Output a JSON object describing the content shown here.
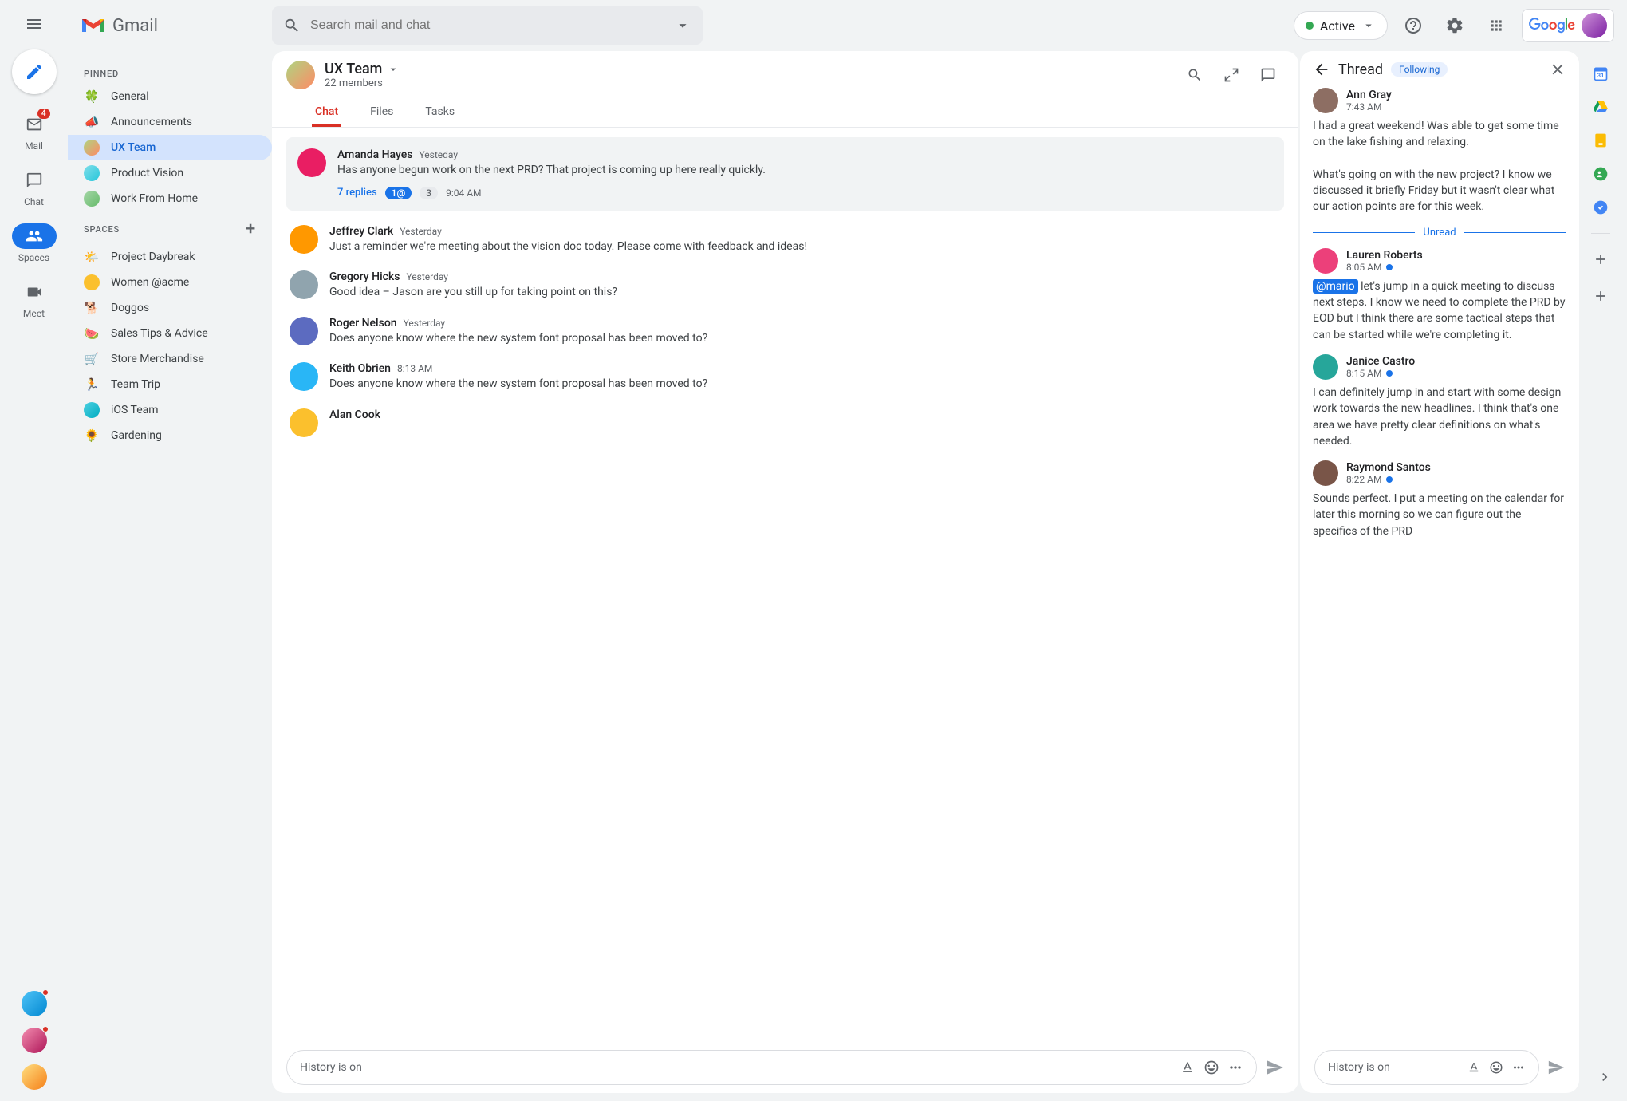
{
  "app_name": "Gmail",
  "search": {
    "placeholder": "Search mail and chat"
  },
  "status": {
    "label": "Active"
  },
  "brand": "Google",
  "rail": {
    "mail": {
      "label": "Mail",
      "badge": "4"
    },
    "chat": {
      "label": "Chat"
    },
    "spaces": {
      "label": "Spaces"
    },
    "meet": {
      "label": "Meet"
    }
  },
  "sidebar": {
    "pinned_heading": "PINNED",
    "spaces_heading": "SPACES",
    "pinned": [
      {
        "emoji": "🍀",
        "label": "General"
      },
      {
        "emoji": "📣",
        "label": "Announcements"
      },
      {
        "emoji": "",
        "label": "UX Team",
        "active": true
      },
      {
        "emoji": "",
        "label": "Product Vision"
      },
      {
        "emoji": "",
        "label": "Work From Home"
      }
    ],
    "spaces": [
      {
        "emoji": "🌤️",
        "label": "Project Daybreak"
      },
      {
        "emoji": "",
        "label": "Women @acme"
      },
      {
        "emoji": "🐕",
        "label": "Doggos"
      },
      {
        "emoji": "🍉",
        "label": "Sales Tips & Advice"
      },
      {
        "emoji": "🛒",
        "label": "Store Merchandise"
      },
      {
        "emoji": "🏃",
        "label": "Team Trip"
      },
      {
        "emoji": "",
        "label": "iOS Team"
      },
      {
        "emoji": "🌻",
        "label": "Gardening"
      }
    ]
  },
  "space": {
    "name": "UX Team",
    "subtitle": "22 members",
    "tabs": [
      "Chat",
      "Files",
      "Tasks"
    ]
  },
  "messages": [
    {
      "name": "Amanda Hayes",
      "time": "Yesteday",
      "body": "Has anyone begun work on the next PRD? That project is coming up here really quickly.",
      "replies": "7 replies",
      "pill1": "1@",
      "pill2": "3",
      "reply_time": "9:04 AM",
      "highlighted": true
    },
    {
      "name": "Jeffrey Clark",
      "time": "Yesterday",
      "body": "Just a reminder we're meeting about the vision doc today. Please come with feedback and ideas!"
    },
    {
      "name": "Gregory Hicks",
      "time": "Yesterday",
      "body": "Good idea – Jason are you still up for taking point on this?"
    },
    {
      "name": "Roger Nelson",
      "time": "Yesterday",
      "body": "Does anyone know where the new system font proposal has been moved to?"
    },
    {
      "name": "Keith Obrien",
      "time": "8:13 AM",
      "body": "Does anyone know where the new system font proposal has been moved to?"
    },
    {
      "name": "Alan Cook",
      "time": "",
      "body": ""
    }
  ],
  "thread": {
    "title": "Thread",
    "following": "Following",
    "unread_label": "Unread",
    "messages": [
      {
        "name": "Ann Gray",
        "time": "7:43 AM",
        "body": "I had a great weekend! Was able to get some time on the lake fishing and relaxing.\n\nWhat's going on with the new project? I know we discussed it briefly Friday but it wasn't clear what our action points are for this week.",
        "unread": false
      },
      {
        "name": "Lauren Roberts",
        "time": "8:05 AM",
        "mention": "@mario",
        "body": " let's jump in a quick meeting to discuss next steps. I know we need to complete the PRD by EOD but I think there are some tactical steps that can be started while we're completing it.",
        "unread": true
      },
      {
        "name": "Janice Castro",
        "time": "8:15 AM",
        "body": "I can definitely jump in and start with some design work towards the new headlines. I think that's one area we have pretty clear definitions on what's needed.",
        "unread": true
      },
      {
        "name": "Raymond Santos",
        "time": "8:22 AM",
        "body": "Sounds perfect. I put a meeting on the calendar for later this morning so we can figure out the specifics of the PRD",
        "unread": true
      }
    ]
  },
  "composer": {
    "placeholder": "History is on"
  },
  "colors": {
    "msg_avatars": [
      "#e91e63",
      "#ff9800",
      "#90a4ae",
      "#5c6bc0",
      "#29b6f6",
      "#fbc02d"
    ],
    "thread_avatars": [
      "#8d6e63",
      "#ec407a",
      "#26a69a",
      "#795548"
    ]
  }
}
